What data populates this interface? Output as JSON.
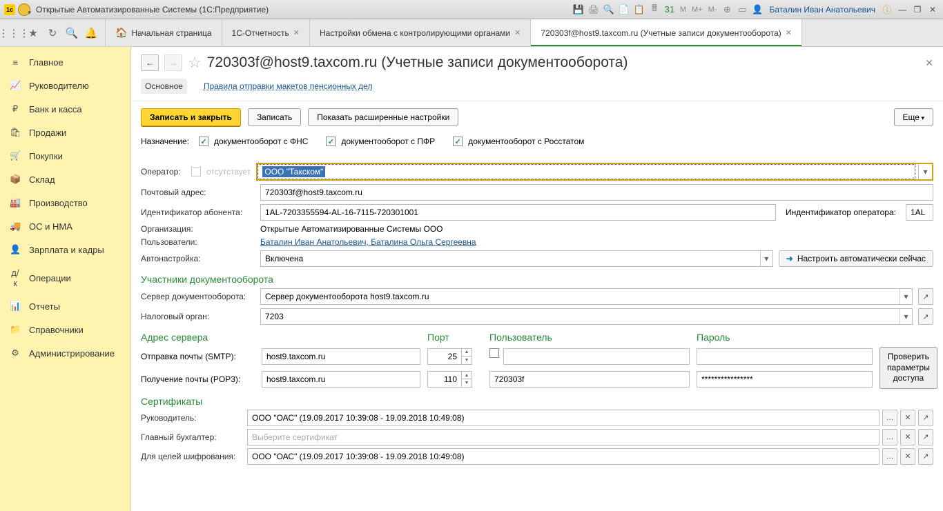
{
  "titlebar": {
    "app_title": "Открытые Автоматизированные Системы  (1С:Предприятие)",
    "user": "Баталин Иван Анатольевич",
    "m_labels": [
      "M",
      "M+",
      "M-"
    ]
  },
  "tabs": {
    "home": "Начальная страница",
    "t1": "1С-Отчетность",
    "t2": "Настройки обмена с контролирующими органами",
    "t3": "720303f@host9.taxcom.ru (Учетные записи документооборота)"
  },
  "sidebar": {
    "items": [
      {
        "label": "Главное"
      },
      {
        "label": "Руководителю"
      },
      {
        "label": "Банк и касса"
      },
      {
        "label": "Продажи"
      },
      {
        "label": "Покупки"
      },
      {
        "label": "Склад"
      },
      {
        "label": "Производство"
      },
      {
        "label": "ОС и НМА"
      },
      {
        "label": "Зарплата и кадры"
      },
      {
        "label": "Операции"
      },
      {
        "label": "Отчеты"
      },
      {
        "label": "Справочники"
      },
      {
        "label": "Администрирование"
      }
    ]
  },
  "page": {
    "title": "720303f@host9.taxcom.ru (Учетные записи документооборота)",
    "subtabs": {
      "main": "Основное",
      "rules": "Правила отправки макетов пенсионных дел"
    },
    "buttons": {
      "save_close": "Записать и закрыть",
      "save": "Записать",
      "advanced": "Показать расширенные настройки",
      "more": "Еще"
    },
    "purpose_label": "Назначение:",
    "checks": {
      "fns": "документооборот с ФНС",
      "pfr": "документооборот с ПФР",
      "rosstat": "документооборот с Росстатом"
    },
    "operator": {
      "label": "Оператор:",
      "absent": "отсутствует",
      "value": "ООО \"Такском\""
    },
    "email": {
      "label": "Почтовый адрес:",
      "value": "720303f@host9.taxcom.ru"
    },
    "subscriber_id": {
      "label": "Идентификатор абонента:",
      "value": "1AL-7203355594-AL-16-7115-720301001"
    },
    "operator_id": {
      "label": "Индентификатор оператора:",
      "value": "1AL"
    },
    "org": {
      "label": "Организация:",
      "value": "Открытые Автоматизированные Системы ООО"
    },
    "users": {
      "label": "Пользователи:",
      "value": "Баталин Иван Анатольевич, Баталина Ольга Сергеевна"
    },
    "autoconf": {
      "label": "Автонастройка:",
      "value": "Включена",
      "btn": "Настроить автоматически сейчас"
    },
    "section_participants": "Участники документооборота",
    "doc_server": {
      "label": "Сервер документооборота:",
      "value": "Сервер документооборота host9.taxcom.ru"
    },
    "tax_auth": {
      "label": "Налоговый орган:",
      "value": "7203"
    },
    "section_server": "Адрес сервера",
    "col_port": "Порт",
    "col_user": "Пользователь",
    "col_pass": "Пароль",
    "smtp": {
      "label": "Отправка почты (SMTP):",
      "host": "host9.taxcom.ru",
      "port": "25"
    },
    "pop3": {
      "label": "Получение почты (POP3):",
      "host": "host9.taxcom.ru",
      "port": "110",
      "user": "720303f",
      "pass": "****************"
    },
    "verify": "Проверить параметры доступа",
    "section_certs": "Сертификаты",
    "cert_mgr": {
      "label": "Руководитель:",
      "value": "ООО \"ОАС\" (19.09.2017 10:39:08 - 19.09.2018 10:49:08)"
    },
    "cert_acc": {
      "label": "Главный бухгалтер:",
      "placeholder": "Выберите сертификат"
    },
    "cert_enc": {
      "label": "Для целей шифрования:",
      "value": "ООО \"ОАС\" (19.09.2017 10:39:08 - 19.09.2018 10:49:08)"
    }
  }
}
